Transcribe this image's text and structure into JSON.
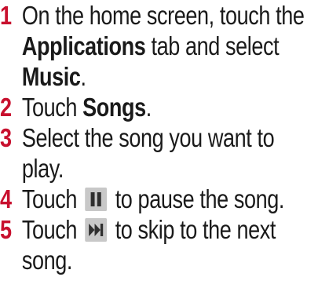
{
  "steps": [
    {
      "number": "1",
      "parts": [
        "On the home screen, touch the",
        "Applications",
        "tab and select",
        "Music",
        "."
      ]
    },
    {
      "number": "2",
      "parts": [
        "Touch",
        "Songs",
        "."
      ]
    },
    {
      "number": "3",
      "text_line1": "Select the song you want to",
      "text_line2": "play."
    },
    {
      "number": "4",
      "before": "Touch",
      "icon": "pause-icon",
      "after": "to pause the song."
    },
    {
      "number": "5",
      "before": "Touch",
      "icon": "skip-next-icon",
      "after_line1": "to skip to the next",
      "after_line2": "song."
    }
  ],
  "colors": {
    "step_number": "#c8102e",
    "icon_fill": "#2f2f2f",
    "icon_bg": "#c8c8c8"
  }
}
